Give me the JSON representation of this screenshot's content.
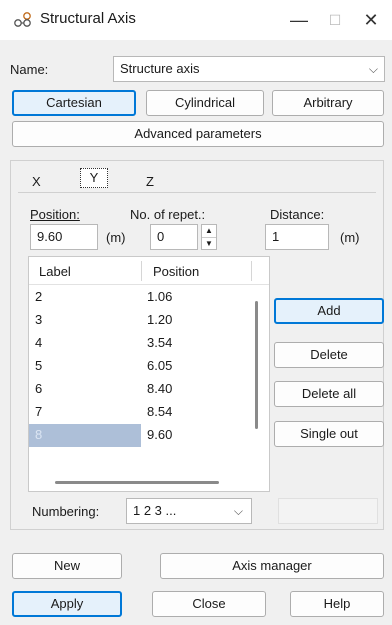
{
  "window": {
    "title": "Structural Axis",
    "app_icon": "structural-axis-icon",
    "controls": {
      "minimize": "—",
      "maximize": "☐",
      "close": "✕"
    }
  },
  "name_row": {
    "label": "Name:",
    "value": "Structure axis"
  },
  "mode_buttons": {
    "cartesian": "Cartesian",
    "cylindrical": "Cylindrical",
    "arbitrary": "Arbitrary"
  },
  "advanced_button": "Advanced parameters",
  "tabs": {
    "x": "X",
    "y": "Y",
    "z": "Z"
  },
  "position": {
    "label": "Position:",
    "value": "9.60",
    "unit": "(m)"
  },
  "repetitions": {
    "label": "No. of repet.:",
    "value": "0"
  },
  "distance": {
    "label": "Distance:",
    "value": "1",
    "unit": "(m)"
  },
  "table": {
    "headers": [
      "Label",
      "Position"
    ],
    "rows": [
      {
        "label": "2",
        "position": "1.06"
      },
      {
        "label": "3",
        "position": "1.20"
      },
      {
        "label": "4",
        "position": "3.54"
      },
      {
        "label": "5",
        "position": "6.05"
      },
      {
        "label": "6",
        "position": "8.40"
      },
      {
        "label": "7",
        "position": "8.54"
      },
      {
        "label": "8",
        "position": "9.60"
      }
    ]
  },
  "side_buttons": {
    "add": "Add",
    "delete": "Delete",
    "delete_all": "Delete all",
    "single_out": "Single out"
  },
  "numbering": {
    "label": "Numbering:",
    "value": "1 2 3 ..."
  },
  "bottom_buttons": {
    "new": "New",
    "axis_manager": "Axis manager",
    "apply": "Apply",
    "close": "Close",
    "help": "Help"
  },
  "colors": {
    "accent": "#0078d7",
    "selection": "#adbfd8"
  }
}
